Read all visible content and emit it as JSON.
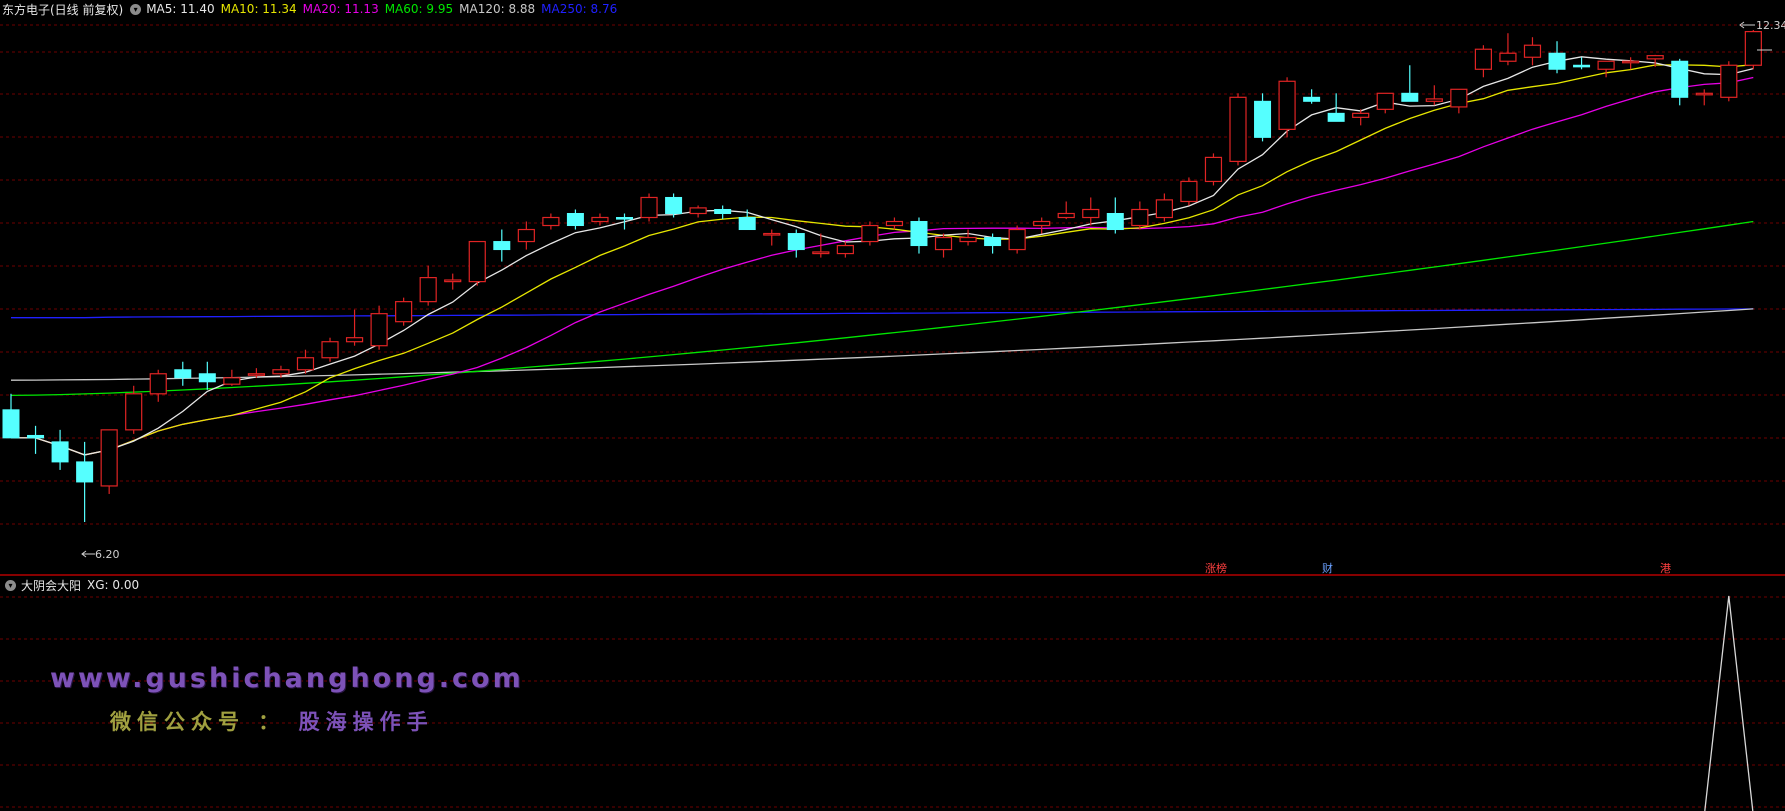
{
  "main_legend": {
    "stock": "东方电子(日线 前复权)",
    "indicators": [
      {
        "label": "MA5: 11.40",
        "color": "#e6e6e6"
      },
      {
        "label": "MA10: 11.34",
        "color": "#e6e600"
      },
      {
        "label": "MA20: 11.13",
        "color": "#e600e6"
      },
      {
        "label": "MA60: 9.95",
        "color": "#00e600"
      },
      {
        "label": "MA120: 8.88",
        "color": "#c8c8c8"
      },
      {
        "label": "MA250: 8.76",
        "color": "#2020ff"
      }
    ]
  },
  "price_labels": {
    "high": "12.34",
    "low": "6.20"
  },
  "markers": [
    "涨榜",
    "财",
    "港"
  ],
  "sub_legend": {
    "title": "大阴会大阳",
    "xg": "XG: 0.00"
  },
  "watermark": {
    "url": "www.gushichanghong.com",
    "cn_part1": "微信公众号",
    "cn_sep": " ： ",
    "cn_part2": "股海操作手"
  },
  "colors": {
    "up": "#e02424",
    "down": "#55ffff",
    "grid": "#6e0000",
    "divider": "#b40000"
  },
  "chart_data": {
    "type": "candlestick",
    "price_range": [
      6.2,
      12.34
    ],
    "ohlc": [
      [
        7.6,
        7.8,
        7.3,
        7.25
      ],
      [
        7.28,
        7.4,
        7.05,
        7.25
      ],
      [
        7.2,
        7.35,
        6.85,
        6.95
      ],
      [
        6.95,
        7.2,
        6.2,
        6.7
      ],
      [
        6.65,
        7.35,
        6.55,
        7.35
      ],
      [
        7.35,
        7.9,
        7.3,
        7.8
      ],
      [
        7.8,
        8.1,
        7.7,
        8.05
      ],
      [
        8.1,
        8.2,
        7.9,
        8.0
      ],
      [
        8.05,
        8.2,
        7.85,
        7.95
      ],
      [
        7.92,
        8.1,
        7.9,
        8.0
      ],
      [
        8.05,
        8.12,
        8.0,
        8.05
      ],
      [
        8.05,
        8.15,
        8.0,
        8.1
      ],
      [
        8.1,
        8.35,
        8.05,
        8.25
      ],
      [
        8.25,
        8.5,
        8.2,
        8.45
      ],
      [
        8.45,
        8.85,
        8.4,
        8.5
      ],
      [
        8.4,
        8.9,
        8.35,
        8.8
      ],
      [
        8.7,
        9.0,
        8.65,
        8.95
      ],
      [
        8.95,
        9.4,
        8.9,
        9.25
      ],
      [
        9.2,
        9.3,
        9.1,
        9.22
      ],
      [
        9.2,
        9.7,
        9.15,
        9.7
      ],
      [
        9.7,
        9.85,
        9.45,
        9.6
      ],
      [
        9.7,
        9.95,
        9.6,
        9.85
      ],
      [
        9.9,
        10.05,
        9.85,
        10.0
      ],
      [
        10.05,
        10.1,
        9.85,
        9.9
      ],
      [
        9.95,
        10.05,
        9.9,
        10.0
      ],
      [
        10.0,
        10.05,
        9.85,
        9.98
      ],
      [
        10.0,
        10.3,
        9.95,
        10.25
      ],
      [
        10.25,
        10.3,
        10.0,
        10.05
      ],
      [
        10.05,
        10.15,
        10.0,
        10.12
      ],
      [
        10.1,
        10.15,
        9.98,
        10.05
      ],
      [
        10.0,
        10.1,
        9.85,
        9.85
      ],
      [
        9.8,
        9.85,
        9.65,
        9.8
      ],
      [
        9.8,
        9.85,
        9.5,
        9.6
      ],
      [
        9.55,
        9.8,
        9.5,
        9.57
      ],
      [
        9.55,
        9.7,
        9.5,
        9.65
      ],
      [
        9.7,
        9.95,
        9.65,
        9.9
      ],
      [
        9.9,
        10.0,
        9.85,
        9.95
      ],
      [
        9.95,
        10.0,
        9.55,
        9.65
      ],
      [
        9.6,
        9.8,
        9.5,
        9.75
      ],
      [
        9.7,
        9.85,
        9.65,
        9.75
      ],
      [
        9.75,
        9.8,
        9.55,
        9.65
      ],
      [
        9.6,
        9.9,
        9.55,
        9.85
      ],
      [
        9.9,
        10.0,
        9.8,
        9.95
      ],
      [
        10.0,
        10.2,
        9.98,
        10.05
      ],
      [
        10.0,
        10.25,
        9.9,
        10.1
      ],
      [
        10.05,
        10.25,
        9.8,
        9.85
      ],
      [
        9.9,
        10.2,
        9.85,
        10.1
      ],
      [
        10.0,
        10.3,
        9.95,
        10.22
      ],
      [
        10.2,
        10.5,
        10.15,
        10.45
      ],
      [
        10.45,
        10.8,
        10.4,
        10.75
      ],
      [
        10.7,
        11.55,
        10.65,
        11.5
      ],
      [
        11.45,
        11.55,
        10.95,
        11.0
      ],
      [
        11.1,
        11.75,
        11.0,
        11.7
      ],
      [
        11.5,
        11.6,
        11.42,
        11.45
      ],
      [
        11.3,
        11.55,
        11.25,
        11.2
      ],
      [
        11.25,
        11.35,
        11.15,
        11.3
      ],
      [
        11.35,
        11.5,
        11.3,
        11.55
      ],
      [
        11.55,
        11.9,
        11.45,
        11.45
      ],
      [
        11.45,
        11.65,
        11.4,
        11.48
      ],
      [
        11.38,
        11.5,
        11.3,
        11.6
      ],
      [
        11.85,
        12.15,
        11.75,
        12.1
      ],
      [
        11.95,
        12.3,
        11.9,
        12.05
      ],
      [
        12.0,
        12.25,
        11.9,
        12.15
      ],
      [
        12.05,
        12.2,
        11.8,
        11.85
      ],
      [
        11.9,
        12.0,
        11.85,
        11.88
      ],
      [
        11.85,
        11.95,
        11.75,
        11.95
      ],
      [
        11.95,
        12.0,
        11.85,
        11.95
      ],
      [
        11.98,
        12.03,
        11.88,
        12.02
      ],
      [
        11.95,
        11.98,
        11.4,
        11.5
      ],
      [
        11.55,
        11.6,
        11.4,
        11.55
      ],
      [
        11.5,
        11.95,
        11.45,
        11.9
      ],
      [
        11.9,
        12.34,
        11.85,
        12.32
      ]
    ],
    "sub_indicator": {
      "name": "XG",
      "value": 0.0,
      "signal_bar_index": 70
    }
  }
}
